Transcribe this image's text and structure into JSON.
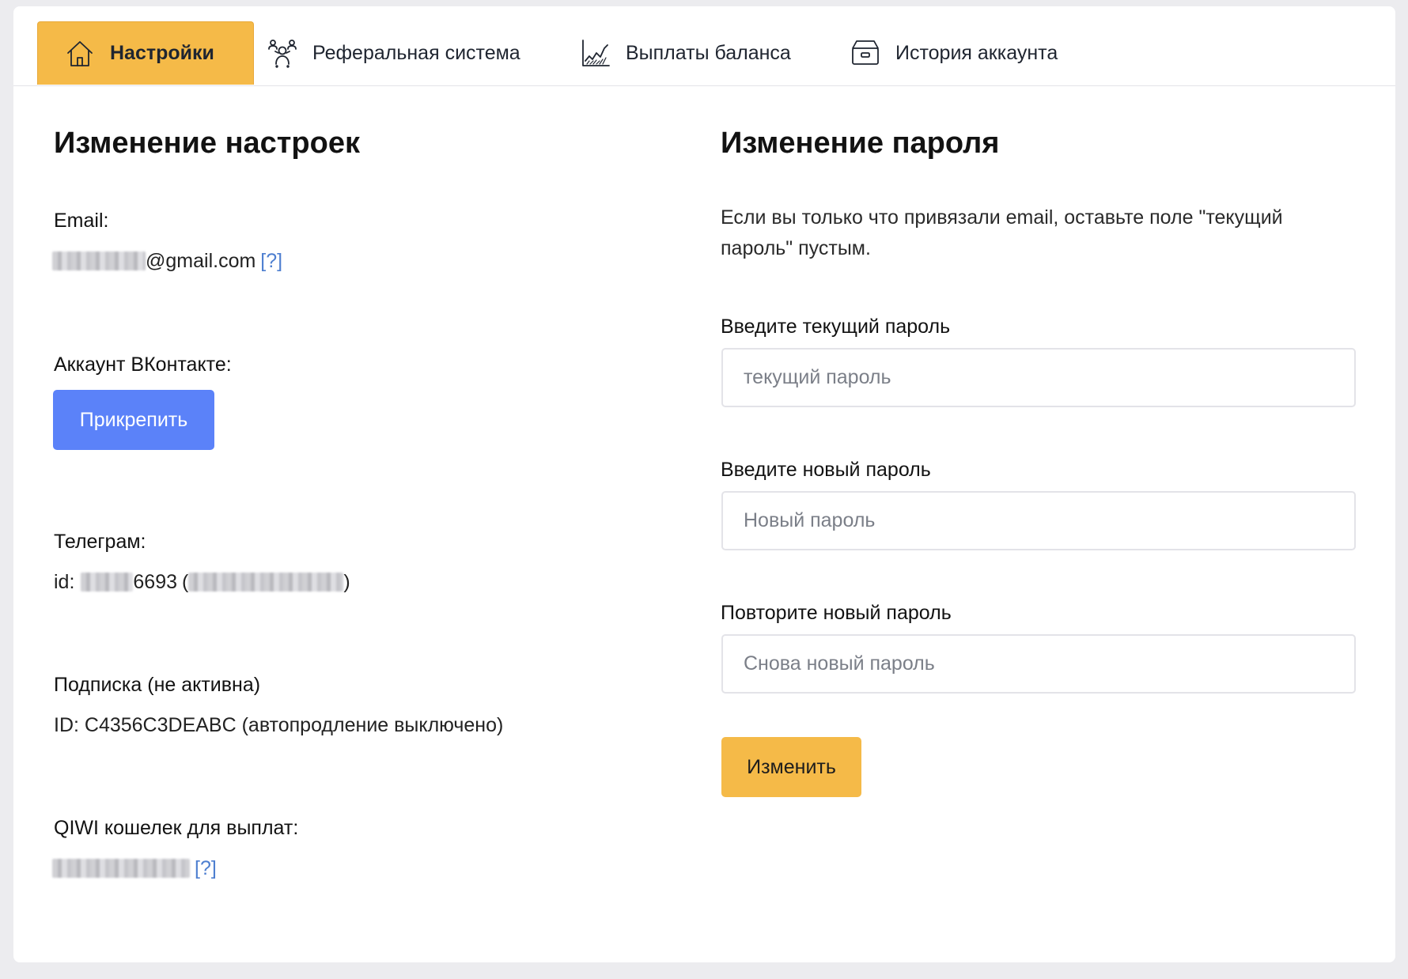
{
  "tabs": [
    {
      "label": "Настройки",
      "icon": "home-icon",
      "active": true
    },
    {
      "label": "Реферальная система",
      "icon": "users-network-icon",
      "active": false
    },
    {
      "label": "Выплаты баланса",
      "icon": "area-chart-icon",
      "active": false
    },
    {
      "label": "История аккаунта",
      "icon": "archive-box-icon",
      "active": false
    }
  ],
  "settings": {
    "title": "Изменение настроек",
    "email_label": "Email:",
    "email_domain": "@gmail.com",
    "help": "[?]",
    "vk_label": "Аккаунт ВКонтакте:",
    "vk_button": "Прикрепить",
    "telegram_label": "Телеграм:",
    "telegram_id_prefix": "id:",
    "telegram_id_suffix": "6693",
    "paren_open": "(",
    "paren_close": ")",
    "subscription_label": "Подписка (не активна)",
    "subscription_value": "ID: C4356C3DEABC (автопродление выключено)",
    "qiwi_label": "QIWI кошелек для выплат:"
  },
  "password": {
    "title": "Изменение пароля",
    "info": "Если вы только что привязали email, оставьте поле \"текущий пароль\" пустым.",
    "current_label": "Введите текущий пароль",
    "current_placeholder": "текущий пароль",
    "new_label": "Введите новый пароль",
    "new_placeholder": "Новый пароль",
    "repeat_label": "Повторите новый пароль",
    "repeat_placeholder": "Снова новый пароль",
    "submit": "Изменить"
  },
  "colors": {
    "accent": "#f5ba48",
    "primary_button": "#5b82f9",
    "link": "#4e7fd0",
    "background": "#ececef"
  }
}
